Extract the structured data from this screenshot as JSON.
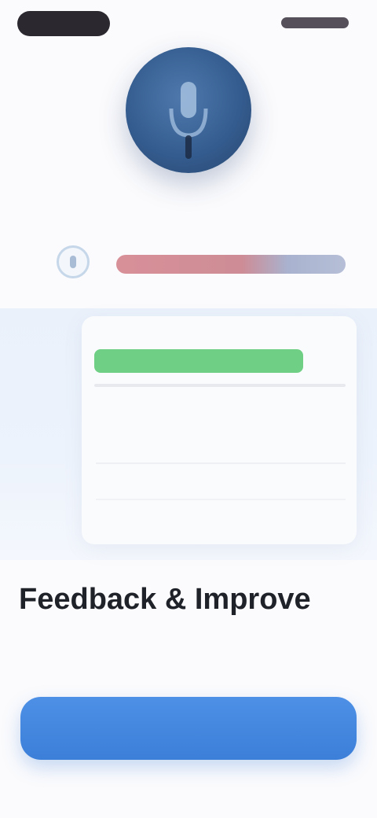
{
  "status_bar": {},
  "hero": {
    "icon": "microphone-icon",
    "color": "#355d90"
  },
  "listening": {
    "label": ""
  },
  "transcript": {
    "icon": "speaker-icon",
    "text": ""
  },
  "card": {
    "title": "",
    "subtitle": "",
    "section_label": "",
    "row_label": "",
    "row_value": "",
    "link": "",
    "title_color": "#6fcf85"
  },
  "feedback": {
    "heading": "Feedback & Improve",
    "description": ""
  },
  "cta": {
    "label": "",
    "color": "#3c7fd9"
  }
}
